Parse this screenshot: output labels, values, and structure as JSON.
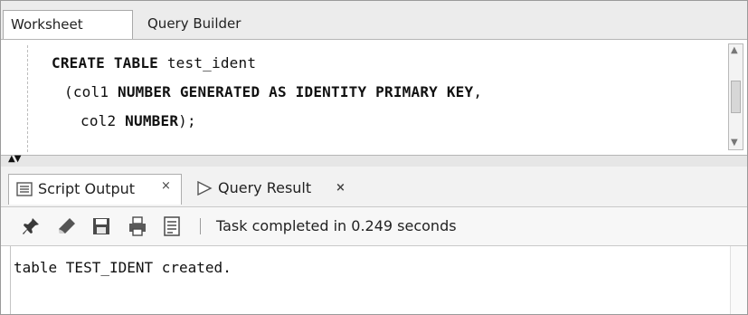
{
  "top_tabs": {
    "worksheet": "Worksheet",
    "query_builder": "Query Builder"
  },
  "editor": {
    "line1_kw": "CREATE TABLE",
    "line1_rest": " test_ident",
    "line2_pre": "(col1 ",
    "line2_kw": "NUMBER GENERATED AS IDENTITY PRIMARY KEY",
    "line2_post": ",",
    "line3_pre": "col2 ",
    "line3_kw": "NUMBER",
    "line3_post": ");"
  },
  "bottom_tabs": {
    "script_output": "Script Output",
    "query_result": "Query Result",
    "close_symbol_1": "×",
    "close_symbol_2": "×"
  },
  "toolbar": {
    "status": "Task completed in 0.249 seconds"
  },
  "output": {
    "text": "table TEST_IDENT created."
  },
  "icons": {
    "pin": "pin-icon",
    "eraser": "eraser-icon",
    "save": "save-icon",
    "print": "print-icon",
    "document": "document-icon",
    "script": "script-output-icon",
    "query_result": "query-result-icon"
  }
}
